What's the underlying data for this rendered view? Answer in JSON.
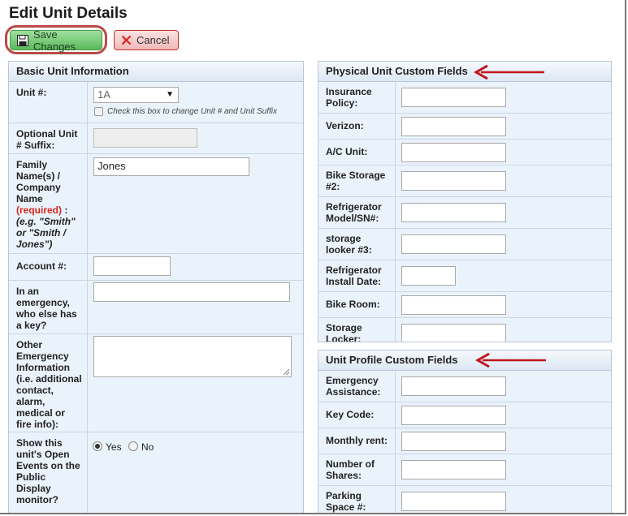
{
  "page": {
    "title": "Edit Unit Details"
  },
  "toolbar": {
    "save_label": "Save Changes",
    "cancel_label": "Cancel"
  },
  "basic": {
    "title": "Basic Unit Information",
    "unit_label": "Unit #:",
    "unit_value": "1A",
    "unit_checkbox_label": "Check this box to change Unit # and Unit Suffix",
    "suffix_label": [
      "Optional Unit",
      "# Suffix:"
    ],
    "family_label": [
      "Family",
      "Name(s) /",
      "Company",
      "Name"
    ],
    "family_required": "(required)",
    "family_colon": " :",
    "family_hint": [
      "(e.g. \"Smith\"",
      "or \"Smith /",
      "Jones\")"
    ],
    "family_value": "Jones",
    "account_label": "Account #:",
    "emergency_key_label": [
      "In an",
      "emergency,",
      "who else has",
      "a key?"
    ],
    "other_emergency_label": [
      "Other",
      "Emergency",
      "Information",
      "(i.e. additional",
      "contact,",
      "alarm,",
      "medical or",
      "fire info):"
    ],
    "show_events_label": [
      "Show this",
      "unit's Open",
      "Events on the",
      "Public",
      "Display",
      "monitor?"
    ],
    "yes_label": "Yes",
    "no_label": "No",
    "show_events_value": "Yes"
  },
  "physical": {
    "title": "Physical Unit Custom Fields",
    "fields": [
      {
        "label": [
          "Insurance",
          "Policy:"
        ],
        "value": ""
      },
      {
        "label": [
          "Verizon:"
        ],
        "value": ""
      },
      {
        "label": [
          "A/C Unit:"
        ],
        "value": ""
      },
      {
        "label": [
          "Bike Storage",
          "#2:"
        ],
        "value": ""
      },
      {
        "label": [
          "Refrigerator",
          "Model/SN#:"
        ],
        "value": ""
      },
      {
        "label": [
          "storage",
          "looker #3:"
        ],
        "value": ""
      },
      {
        "label": [
          "Refrigerator",
          "Install Date:"
        ],
        "value": ""
      },
      {
        "label": [
          "Bike Room:"
        ],
        "value": ""
      },
      {
        "label": [
          "Storage",
          "Locker:"
        ],
        "value": ""
      }
    ]
  },
  "profile": {
    "title": "Unit Profile Custom Fields",
    "fields": [
      {
        "label": [
          "Emergency",
          "Assistance:"
        ],
        "value": ""
      },
      {
        "label": [
          "Key Code:"
        ],
        "value": ""
      },
      {
        "label": [
          "Monthly rent:"
        ],
        "value": ""
      },
      {
        "label": [
          "Number of",
          "Shares:"
        ],
        "value": ""
      },
      {
        "label": [
          "Parking",
          "Space #:"
        ],
        "value": ""
      }
    ]
  },
  "colors": {
    "arrow": "#c0141c",
    "save_green": "#5cb85c",
    "cancel_red": "#c9302c",
    "ring": "#b94a48"
  }
}
